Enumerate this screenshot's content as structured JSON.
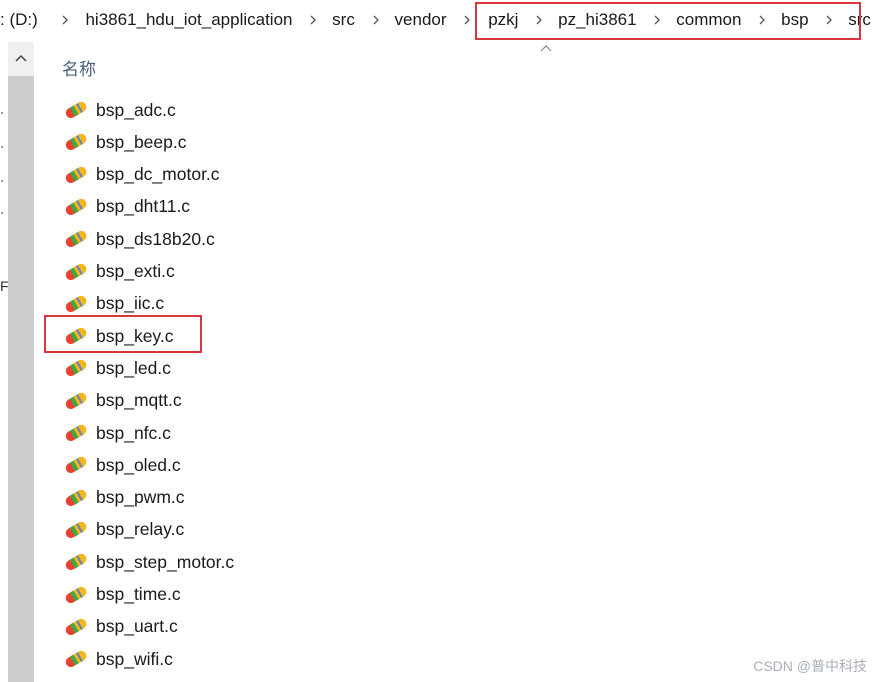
{
  "breadcrumb": {
    "items": [
      {
        "label": ": (D:)"
      },
      {
        "label": "hi3861_hdu_iot_application"
      },
      {
        "label": "src"
      },
      {
        "label": "vendor"
      },
      {
        "label": "pzkj"
      },
      {
        "label": "pz_hi3861"
      },
      {
        "label": "common"
      },
      {
        "label": "bsp"
      },
      {
        "label": "src"
      }
    ]
  },
  "nav_pane": {
    "partial_letter": "F"
  },
  "file_list": {
    "column_header": "名称",
    "files": [
      {
        "name": "bsp_adc.c"
      },
      {
        "name": "bsp_beep.c"
      },
      {
        "name": "bsp_dc_motor.c"
      },
      {
        "name": "bsp_dht11.c"
      },
      {
        "name": "bsp_ds18b20.c"
      },
      {
        "name": "bsp_exti.c"
      },
      {
        "name": "bsp_iic.c"
      },
      {
        "name": "bsp_key.c"
      },
      {
        "name": "bsp_led.c"
      },
      {
        "name": "bsp_mqtt.c"
      },
      {
        "name": "bsp_nfc.c"
      },
      {
        "name": "bsp_oled.c"
      },
      {
        "name": "bsp_pwm.c"
      },
      {
        "name": "bsp_relay.c"
      },
      {
        "name": "bsp_step_motor.c"
      },
      {
        "name": "bsp_time.c"
      },
      {
        "name": "bsp_uart.c"
      },
      {
        "name": "bsp_wifi.c"
      }
    ]
  },
  "icons": {
    "file_icon": "c-source-file-icon",
    "separator": "chevron-right-icon",
    "scroll_up": "chevron-up-icon",
    "sort": "sort-ascending-icon"
  },
  "colors": {
    "highlight": "#d9363e",
    "header_text": "#4c607a",
    "scroll_thumb": "#cdcdcd"
  },
  "watermark": "CSDN @普中科技"
}
